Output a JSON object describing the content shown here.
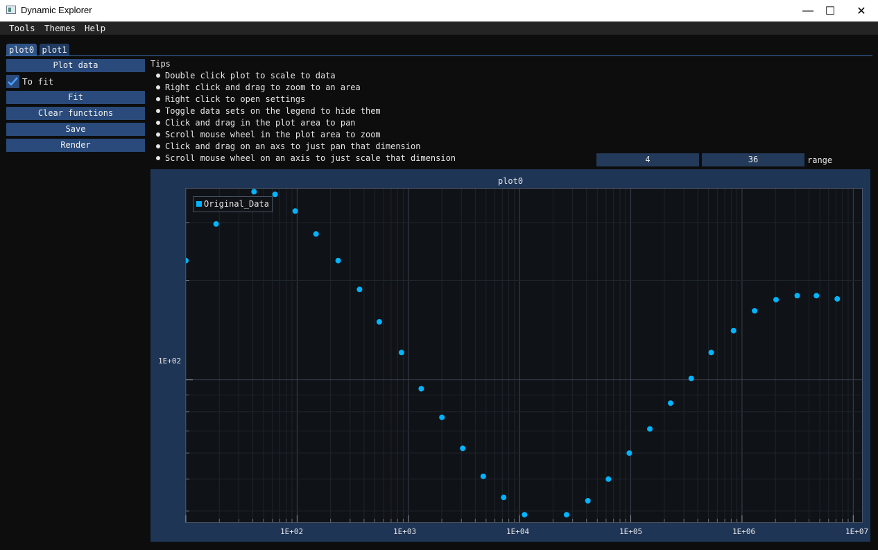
{
  "window": {
    "title": "Dynamic Explorer",
    "minimize": "—",
    "maximize": "☐",
    "close": "✕"
  },
  "menu": [
    "Tools",
    "Themes",
    "Help"
  ],
  "tabs": [
    "plot0",
    "plot1"
  ],
  "sidebar": {
    "plot_data": "Plot data",
    "to_fit_label": "To fit",
    "to_fit_checked": true,
    "fit": "Fit",
    "clear_functions": "Clear functions",
    "save": "Save",
    "render": "Render"
  },
  "tips": {
    "title": "Tips",
    "items": [
      "Double click plot to scale to data",
      "Right click and drag to zoom to an area",
      "Right click to open settings",
      "Toggle data sets on the legend to hide them",
      "Click and drag in the plot area to pan",
      "Scroll mouse wheel in the plot area to zoom",
      "Click and drag on an axs to just pan that dimension",
      "Scroll mouse wheel on an axis to just scale that dimension"
    ]
  },
  "range": {
    "min": "4",
    "max": "36",
    "label": "range"
  },
  "colors": {
    "accent": "#2d5385",
    "point": "#00b4ff",
    "frame": "#1f3556"
  },
  "chart_data": {
    "type": "scatter",
    "title": "plot0",
    "xscale": "log",
    "yscale": "log",
    "xlim": [
      10,
      12000000
    ],
    "ylim": [
      37,
      380
    ],
    "x_ticks": [
      "1E+02",
      "1E+03",
      "1E+04",
      "1E+05",
      "1E+06",
      "1E+07"
    ],
    "y_ticks": [
      "1E+02"
    ],
    "legend": "top-left",
    "series": [
      {
        "name": "Original_Data",
        "points": [
          [
            10,
            230
          ],
          [
            18.7,
            297
          ],
          [
            41,
            372
          ],
          [
            63.4,
            365
          ],
          [
            96.2,
            325
          ],
          [
            148,
            277
          ],
          [
            234,
            230
          ],
          [
            364,
            188
          ],
          [
            548,
            150
          ],
          [
            868,
            121
          ],
          [
            1306,
            94
          ],
          [
            2004,
            77
          ],
          [
            3085,
            62
          ],
          [
            4714,
            51
          ],
          [
            7197,
            44
          ],
          [
            11088,
            39
          ],
          [
            26437,
            39
          ],
          [
            41180,
            43
          ],
          [
            62990,
            50
          ],
          [
            97050,
            60
          ],
          [
            148300,
            71
          ],
          [
            227900,
            85
          ],
          [
            349500,
            101
          ],
          [
            528800,
            121
          ],
          [
            839600,
            141
          ],
          [
            1298000,
            162
          ],
          [
            2023000,
            175
          ],
          [
            3133000,
            180
          ],
          [
            4667000,
            180
          ],
          [
            7174000,
            176
          ]
        ]
      }
    ]
  }
}
